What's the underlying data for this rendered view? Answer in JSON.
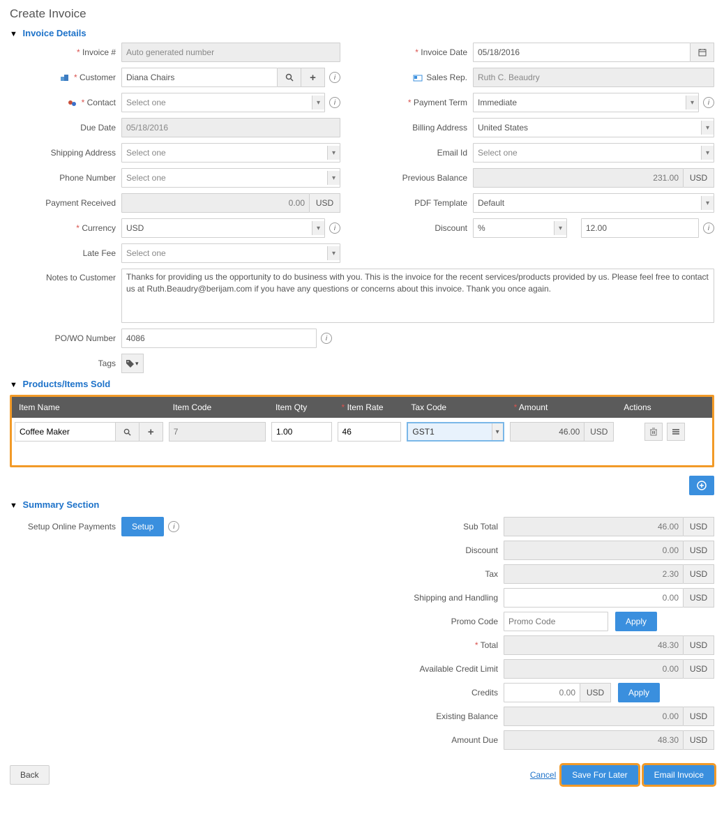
{
  "page_title": "Create Invoice",
  "sections": {
    "invoice_details": "Invoice Details",
    "products": "Products/Items Sold",
    "summary": "Summary Section"
  },
  "labels": {
    "invoice_no": "Invoice #",
    "customer": "Customer",
    "contact": "Contact",
    "due_date": "Due Date",
    "shipping_address": "Shipping Address",
    "phone_number": "Phone Number",
    "payment_received": "Payment Received",
    "currency": "Currency",
    "late_fee": "Late Fee",
    "notes": "Notes to Customer",
    "powo": "PO/WO Number",
    "tags": "Tags",
    "invoice_date": "Invoice Date",
    "sales_rep": "Sales Rep.",
    "payment_term": "Payment Term",
    "billing_address": "Billing Address",
    "email_id": "Email Id",
    "previous_balance": "Previous Balance",
    "pdf_template": "PDF Template",
    "discount": "Discount",
    "setup_payments": "Setup Online Payments",
    "sub_total": "Sub Total",
    "discount_s": "Discount",
    "tax": "Tax",
    "shipping_handling": "Shipping and Handling",
    "promo_code": "Promo Code",
    "total": "Total",
    "avail_credit": "Available Credit Limit",
    "credits": "Credits",
    "existing_balance": "Existing Balance",
    "amount_due": "Amount Due"
  },
  "placeholders": {
    "select_one": "Select one",
    "promo_code": "Promo Code"
  },
  "values": {
    "invoice_no": "Auto generated number",
    "customer": "Diana Chairs",
    "due_date": "05/18/2016",
    "payment_received": "0.00",
    "currency": "USD",
    "notes": "Thanks for providing us the opportunity to do business with you. This is the invoice for the recent services/products provided by us. Please feel free to contact us at Ruth.Beaudry@berijam.com if you have any questions or concerns about this invoice. Thank you once again.",
    "powo": "4086",
    "invoice_date": "05/18/2016",
    "sales_rep": "Ruth C. Beaudry",
    "payment_term": "Immediate",
    "billing_address": "United States",
    "previous_balance": "231.00",
    "pdf_template": "Default",
    "discount_type": "%",
    "discount_value": "12.00"
  },
  "usd": "USD",
  "ptable": {
    "headers": {
      "item_name": "Item Name",
      "item_code": "Item Code",
      "item_qty": "Item Qty",
      "item_rate": "Item Rate",
      "tax_code": "Tax Code",
      "amount": "Amount",
      "actions": "Actions"
    },
    "rows": [
      {
        "name": "Coffee Maker",
        "code": "7",
        "qty": "1.00",
        "rate": "46",
        "tax": "GST1",
        "amount": "46.00",
        "amount_unit": "USD"
      }
    ]
  },
  "summary": {
    "sub_total": "46.00",
    "discount": "0.00",
    "tax": "2.30",
    "shipping": "0.00",
    "total": "48.30",
    "avail_credit": "0.00",
    "credits": "0.00",
    "existing_balance": "0.00",
    "amount_due": "48.30"
  },
  "buttons": {
    "setup": "Setup",
    "apply": "Apply",
    "back": "Back",
    "cancel": "Cancel",
    "save_for_later": "Save For Later",
    "email_invoice": "Email Invoice"
  }
}
